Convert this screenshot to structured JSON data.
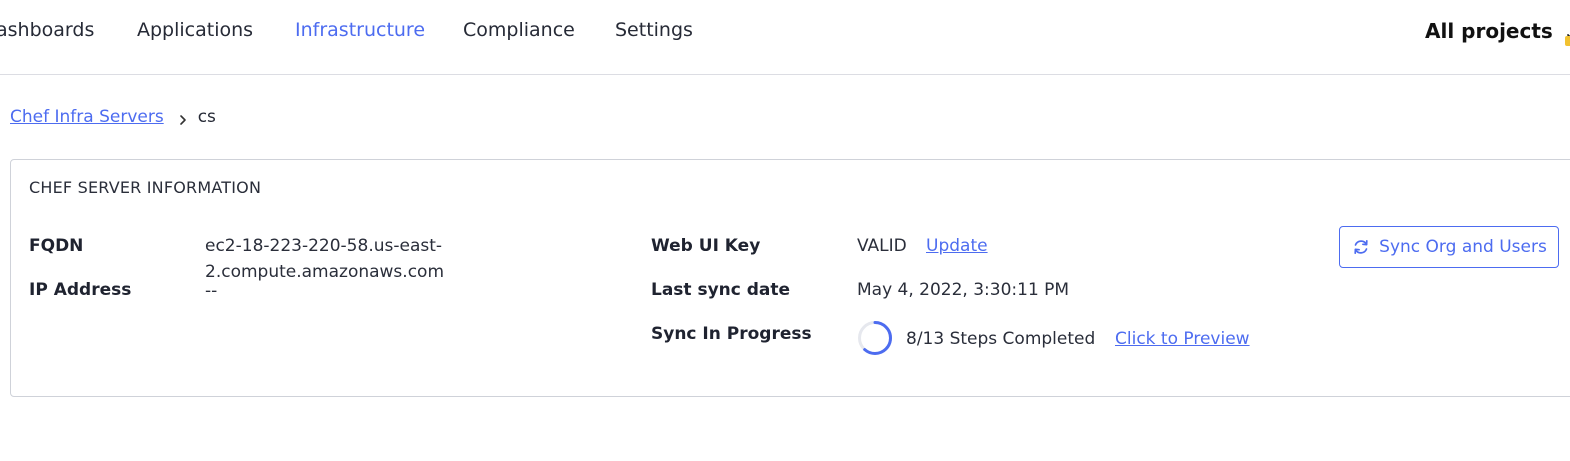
{
  "nav": {
    "items": [
      {
        "label": "ashboards",
        "active": false
      },
      {
        "label": "Applications",
        "active": false
      },
      {
        "label": "Infrastructure",
        "active": true
      },
      {
        "label": "Compliance",
        "active": false
      },
      {
        "label": "Settings",
        "active": false
      }
    ],
    "projects_label": "All projects"
  },
  "breadcrumb": {
    "parent": "Chef Infra Servers",
    "current": "cs"
  },
  "card": {
    "title": "CHEF SERVER INFORMATION",
    "fqdn_label": "FQDN",
    "fqdn_value": "ec2-18-223-220-58.us-east-2.compute.amazonaws.com",
    "ip_label": "IP Address",
    "ip_value": "--",
    "webui_label": "Web UI Key",
    "webui_value": "VALID",
    "update_link": "Update",
    "last_sync_label": "Last sync date",
    "last_sync_value": "May 4, 2022, 3:30:11 PM",
    "sync_progress_label": "Sync In Progress",
    "sync_progress_value": "8/13 Steps Completed",
    "preview_link": "Click to Preview",
    "sync_button": "Sync Org and Users",
    "progress_fraction": 0.615
  },
  "colors": {
    "accent": "#4d6cf0",
    "border": "#cfd2d9"
  }
}
